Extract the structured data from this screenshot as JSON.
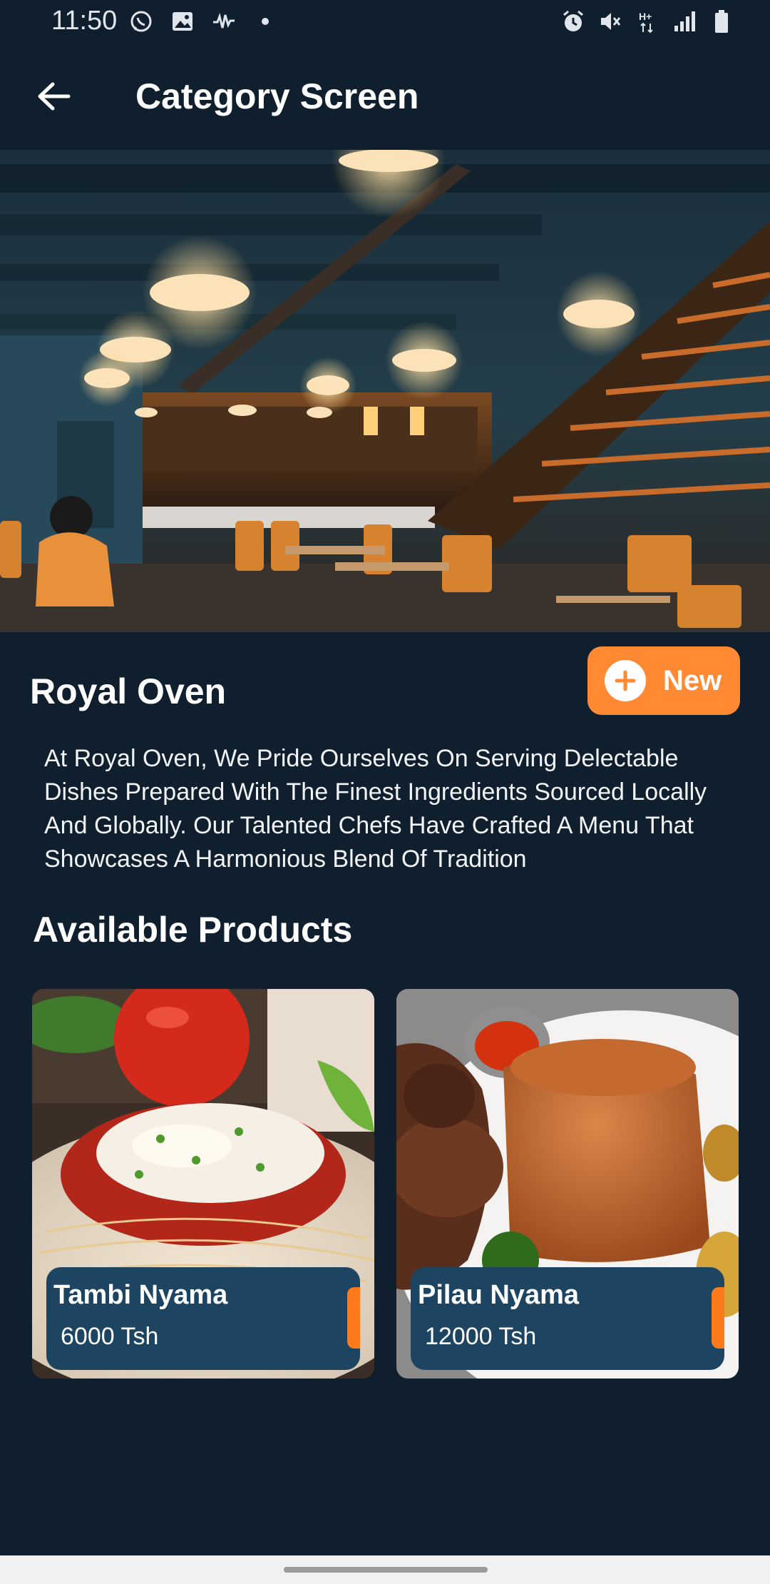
{
  "status_bar": {
    "time": "11:50",
    "left_icons": [
      "whatsapp-icon",
      "gallery-icon",
      "voice-activity-icon",
      "dot-icon"
    ],
    "right_icons": [
      "alarm-icon",
      "mute-icon",
      "network-hplus-icon",
      "signal-icon",
      "battery-icon"
    ]
  },
  "appbar": {
    "title": "Category Screen",
    "back_icon": "arrow-left-icon"
  },
  "hero": {
    "description": "restaurant interior photo"
  },
  "shop": {
    "name": "Royal Oven",
    "new_button_label": "New",
    "new_button_icon": "plus-circle-icon",
    "description": " At Royal Oven, We Pride Ourselves On Serving Delectable Dishes Prepared With The Finest Ingredients Sourced Locally And Globally. Our Talented Chefs Have Crafted A Menu That Showcases A Harmonious Blend Of Tradition"
  },
  "products_section": {
    "title": "Available Products",
    "items": [
      {
        "name": "Tambi Nyama",
        "price": "6000 Tsh"
      },
      {
        "name": "Pilau Nyama",
        "price": "12000 Tsh"
      }
    ]
  },
  "colors": {
    "background": "#0f1f2e",
    "accent": "#ff8a33",
    "card_info": "#1d4461",
    "nav_bar": "#f1f1f1"
  }
}
